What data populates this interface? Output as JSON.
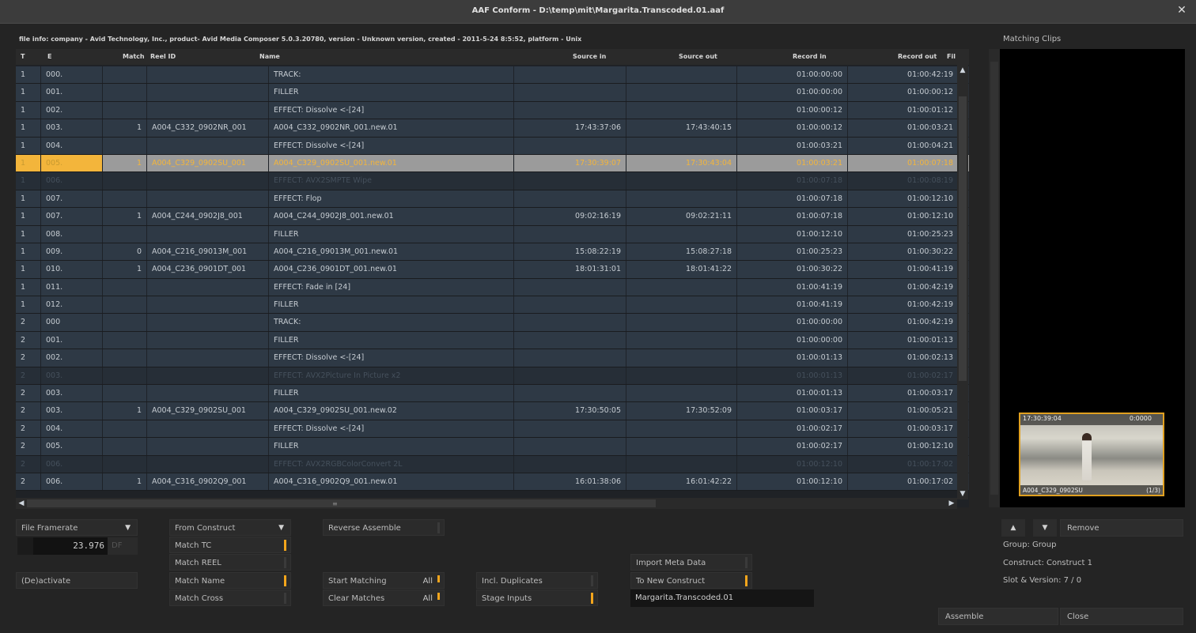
{
  "window": {
    "title": "AAF Conform - D:\\temp\\mit\\Margarita.Transcoded.01.aaf",
    "close_glyph": "✕"
  },
  "file_info": "file info: company - Avid Technology, Inc., product- Avid Media Composer 5.0.3.20780, version - Unknown version, created - 2011-5-24 8:5:52, platform - Unix",
  "table": {
    "headers": {
      "t": "T",
      "e": "E",
      "match": "Match",
      "reel": "Reel ID",
      "name": "Name",
      "source_in": "Source in",
      "source_out": "Source out",
      "record_in": "Record in",
      "record_out": "Record out",
      "fil": "Fil"
    },
    "rows": [
      {
        "t": "1",
        "e": "000.",
        "match": "",
        "reel": "",
        "name": "TRACK:",
        "si": "",
        "so": "",
        "ri": "01:00:00:00",
        "ro": "01:00:42:19",
        "fil": "",
        "state": "normal"
      },
      {
        "t": "1",
        "e": "001.",
        "match": "",
        "reel": "",
        "name": "FILLER",
        "si": "",
        "so": "",
        "ri": "01:00:00:00",
        "ro": "01:00:00:12",
        "fil": "",
        "state": "normal"
      },
      {
        "t": "1",
        "e": "002.",
        "match": "",
        "reel": "",
        "name": "EFFECT: Dissolve <-[24]",
        "si": "",
        "so": "",
        "ri": "01:00:00:12",
        "ro": "01:00:01:12",
        "fil": "",
        "state": "normal"
      },
      {
        "t": "1",
        "e": "003.",
        "match": "1",
        "reel": "A004_C332_0902NR_001",
        "name": "A004_C332_0902NR_001.new.01",
        "si": "17:43:37:06",
        "so": "17:43:40:15",
        "ri": "01:00:00:12",
        "ro": "01:00:03:21",
        "fil": "..\\",
        "state": "normal"
      },
      {
        "t": "1",
        "e": "004.",
        "match": "",
        "reel": "",
        "name": "EFFECT: Dissolve <-[24]",
        "si": "",
        "so": "",
        "ri": "01:00:03:21",
        "ro": "01:00:04:21",
        "fil": "",
        "state": "normal"
      },
      {
        "t": "1",
        "e": "005.",
        "match": "1",
        "reel": "A004_C329_0902SU_001",
        "name": "A004_C329_0902SU_001.new.01",
        "si": "17:30:39:07",
        "so": "17:30:43:04",
        "ri": "01:00:03:21",
        "ro": "01:00:07:18",
        "fil": "..n",
        "state": "sel"
      },
      {
        "t": "1",
        "e": "006.",
        "match": "",
        "reel": "",
        "name": "EFFECT: AVX2SMPTE Wipe",
        "si": "",
        "so": "",
        "ri": "01:00:07:18",
        "ro": "01:00:08:19",
        "fil": "",
        "state": "dim"
      },
      {
        "t": "1",
        "e": "007.",
        "match": "",
        "reel": "",
        "name": "EFFECT: Flop",
        "si": "",
        "so": "",
        "ri": "01:00:07:18",
        "ro": "01:00:12:10",
        "fil": "",
        "state": "normal"
      },
      {
        "t": "1",
        "e": "007.",
        "match": "1",
        "reel": "A004_C244_0902J8_001",
        "name": "A004_C244_0902J8_001.new.01",
        "si": "09:02:16:19",
        "so": "09:02:21:11",
        "ri": "01:00:07:18",
        "ro": "01:00:12:10",
        "fil": "..e",
        "state": "normal"
      },
      {
        "t": "1",
        "e": "008.",
        "match": "",
        "reel": "",
        "name": "FILLER",
        "si": "",
        "so": "",
        "ri": "01:00:12:10",
        "ro": "01:00:25:23",
        "fil": "",
        "state": "normal"
      },
      {
        "t": "1",
        "e": "009.",
        "match": "0",
        "reel": "A004_C216_09013M_001",
        "name": "A004_C216_09013M_001.new.01",
        "si": "15:08:22:19",
        "so": "15:08:27:18",
        "ri": "01:00:25:23",
        "ro": "01:00:30:22",
        "fil": "..\\",
        "state": "normal"
      },
      {
        "t": "1",
        "e": "010.",
        "match": "1",
        "reel": "A004_C236_0901DT_001",
        "name": "A004_C236_0901DT_001.new.01",
        "si": "18:01:31:01",
        "so": "18:01:41:22",
        "ri": "01:00:30:22",
        "ro": "01:00:41:19",
        "fil": "..n",
        "state": "normal"
      },
      {
        "t": "1",
        "e": "011.",
        "match": "",
        "reel": "",
        "name": "EFFECT: Fade in [24]",
        "si": "",
        "so": "",
        "ri": "01:00:41:19",
        "ro": "01:00:42:19",
        "fil": "",
        "state": "normal"
      },
      {
        "t": "1",
        "e": "012.",
        "match": "",
        "reel": "",
        "name": "FILLER",
        "si": "",
        "so": "",
        "ri": "01:00:41:19",
        "ro": "01:00:42:19",
        "fil": "",
        "state": "normal"
      },
      {
        "t": "2",
        "e": "000",
        "match": "",
        "reel": "",
        "name": "TRACK:",
        "si": "",
        "so": "",
        "ri": "01:00:00:00",
        "ro": "01:00:42:19",
        "fil": "",
        "state": "normal"
      },
      {
        "t": "2",
        "e": "001.",
        "match": "",
        "reel": "",
        "name": "FILLER",
        "si": "",
        "so": "",
        "ri": "01:00:00:00",
        "ro": "01:00:01:13",
        "fil": "",
        "state": "normal"
      },
      {
        "t": "2",
        "e": "002.",
        "match": "",
        "reel": "",
        "name": "EFFECT: Dissolve <-[24]",
        "si": "",
        "so": "",
        "ri": "01:00:01:13",
        "ro": "01:00:02:13",
        "fil": "",
        "state": "normal"
      },
      {
        "t": "2",
        "e": "003.",
        "match": "",
        "reel": "",
        "name": "EFFECT: AVX2Picture In Picture x2",
        "si": "",
        "so": "",
        "ri": "01:00:01:13",
        "ro": "01:00:02:17",
        "fil": "",
        "state": "dim"
      },
      {
        "t": "2",
        "e": "003.",
        "match": "",
        "reel": "",
        "name": "FILLER",
        "si": "",
        "so": "",
        "ri": "01:00:01:13",
        "ro": "01:00:03:17",
        "fil": "",
        "state": "normal"
      },
      {
        "t": "2",
        "e": "003.",
        "match": "1",
        "reel": "A004_C329_0902SU_001",
        "name": "A004_C329_0902SU_001.new.02",
        "si": "17:30:50:05",
        "so": "17:30:52:09",
        "ri": "01:00:03:17",
        "ro": "01:00:05:21",
        "fil": "..n",
        "state": "normal"
      },
      {
        "t": "2",
        "e": "004.",
        "match": "",
        "reel": "",
        "name": "EFFECT: Dissolve <-[24]",
        "si": "",
        "so": "",
        "ri": "01:00:02:17",
        "ro": "01:00:03:17",
        "fil": "",
        "state": "normal"
      },
      {
        "t": "2",
        "e": "005.",
        "match": "",
        "reel": "",
        "name": "FILLER",
        "si": "",
        "so": "",
        "ri": "01:00:02:17",
        "ro": "01:00:12:10",
        "fil": "",
        "state": "normal"
      },
      {
        "t": "2",
        "e": "006.",
        "match": "",
        "reel": "",
        "name": "EFFECT: AVX2RGBColorConvert 2L",
        "si": "",
        "so": "",
        "ri": "01:00:12:10",
        "ro": "01:00:17:02",
        "fil": "",
        "state": "dim"
      },
      {
        "t": "2",
        "e": "006.",
        "match": "1",
        "reel": "A004_C316_0902Q9_001",
        "name": "A004_C316_0902Q9_001.new.01",
        "si": "16:01:38:06",
        "so": "16:01:42:22",
        "ri": "01:00:12:10",
        "ro": "01:00:17:02",
        "fil": "..n",
        "state": "normal"
      }
    ]
  },
  "matching_clips": {
    "label": "Matching Clips",
    "thumb_tc": "17:30:39:04",
    "thumb_tc2": "0:0000",
    "thumb_clip": "A004_C329_0902SU",
    "thumb_clip2": "(1/3)"
  },
  "controls": {
    "file_framerate": "File Framerate",
    "framerate_value": "23.976",
    "df": "DF",
    "deactivate": "(De)activate",
    "from_construct": "From Construct",
    "match_tc": "Match TC",
    "match_reel": "Match REEL",
    "match_name": "Match Name",
    "match_cross": "Match Cross",
    "reverse_assemble": "Reverse Assemble",
    "start_matching": "Start Matching",
    "clear_matches": "Clear Matches",
    "all": "All",
    "incl_duplicates": "Incl. Duplicates",
    "stage_inputs": "Stage Inputs",
    "import_meta_data": "Import Meta Data",
    "to_new_construct": "To New Construct",
    "construct_name": "Margarita.Transcoded.01",
    "remove": "Remove",
    "group": "Group: Group",
    "construct": "Construct: Construct 1",
    "slot_version": "Slot & Version: 7 / 0",
    "assemble": "Assemble",
    "close": "Close"
  },
  "colors": {
    "accent": "#f3a51c",
    "row_bg": "#2e3945",
    "selected_bg": "#9b9b9b"
  }
}
